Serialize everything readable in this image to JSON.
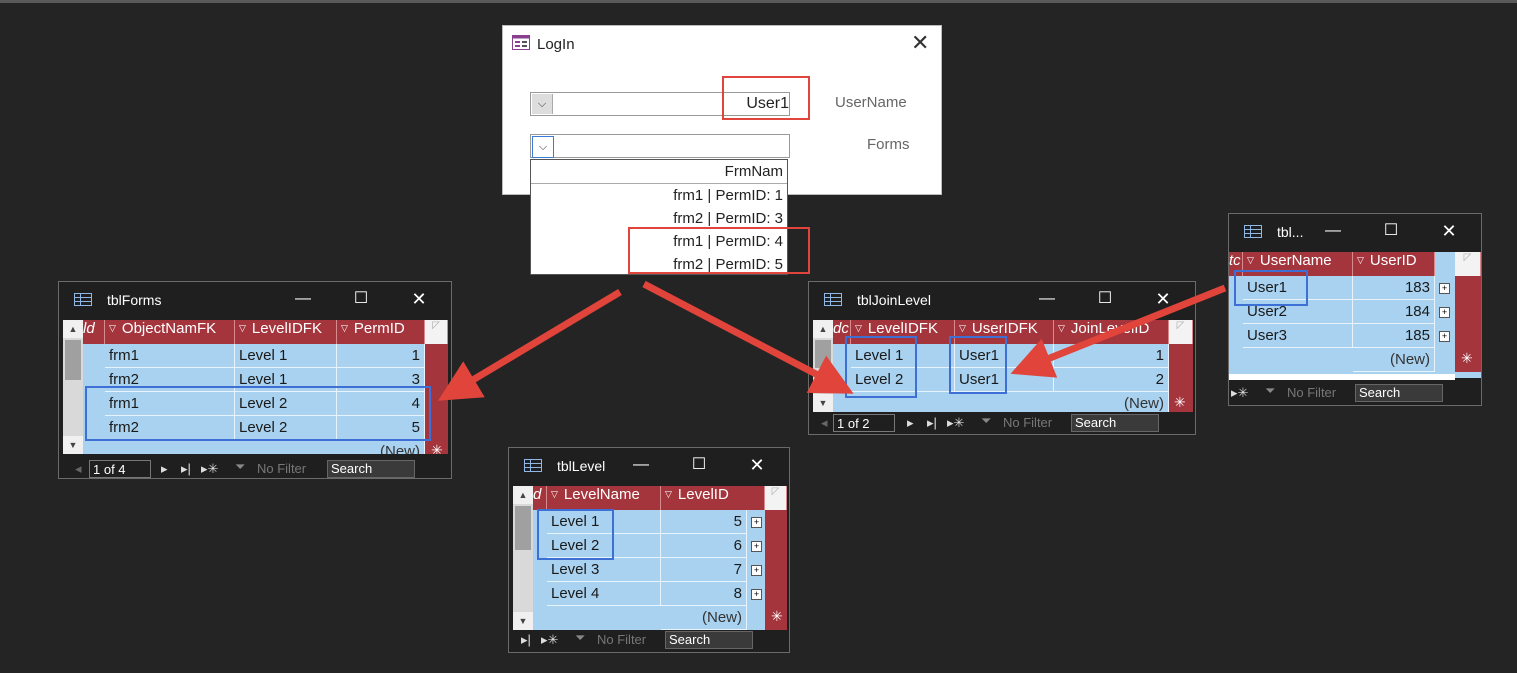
{
  "login": {
    "title": "LogIn",
    "username_label": "UserName",
    "username_value": "User1",
    "forms_label": "Forms",
    "forms_value": "",
    "dropdown": {
      "header": "FrmNam",
      "items": [
        "frm1 | PermID: 1",
        "frm2 | PermID: 3",
        "frm1 | PermID: 4",
        "frm2 | PermID: 5"
      ]
    }
  },
  "tblForms": {
    "title": "tblForms",
    "columns": [
      "ld",
      "ObjectNamFK",
      "LevelIDFK",
      "PermID"
    ],
    "rows": [
      [
        "frm1",
        "Level 1",
        "1"
      ],
      [
        "frm2",
        "Level 1",
        "3"
      ],
      [
        "frm1",
        "Level 2",
        "4"
      ],
      [
        "frm2",
        "Level 2",
        "5"
      ]
    ],
    "new_row": "(New)",
    "nav_record": "1 of 4",
    "filter": "No Filter",
    "search": "Search"
  },
  "tblLevel": {
    "title": "tblLevel",
    "columns": [
      "d",
      "LevelName",
      "LevelID"
    ],
    "rows": [
      [
        "Level 1",
        "5"
      ],
      [
        "Level 2",
        "6"
      ],
      [
        "Level 3",
        "7"
      ],
      [
        "Level 4",
        "8"
      ]
    ],
    "new_row": "(New)",
    "filter": "No Filter",
    "search": "Search"
  },
  "tblJoinLevel": {
    "title": "tblJoinLevel",
    "columns": [
      "dc",
      "LevelIDFK",
      "UserIDFK",
      "JoinLevelID"
    ],
    "rows": [
      [
        "Level 1",
        "User1",
        "1"
      ],
      [
        "Level 2",
        "User1",
        "2"
      ]
    ],
    "new_row": "(New)",
    "nav_record": "1 of 2",
    "filter": "No Filter",
    "search": "Search"
  },
  "tblUsers": {
    "title": "tbl...",
    "columns": [
      "tc",
      "UserName",
      "UserID"
    ],
    "rows": [
      [
        "User1",
        "183"
      ],
      [
        "User2",
        "184"
      ],
      [
        "User3",
        "185"
      ]
    ],
    "new_row": "(New)",
    "filter": "No Filter",
    "search": "Search"
  },
  "colors": {
    "header": "#a4353d",
    "row": "#a9d2f0",
    "highlight_blue": "#3d6fd4",
    "highlight_red": "#e0443a",
    "arrow": "#e0443a"
  }
}
